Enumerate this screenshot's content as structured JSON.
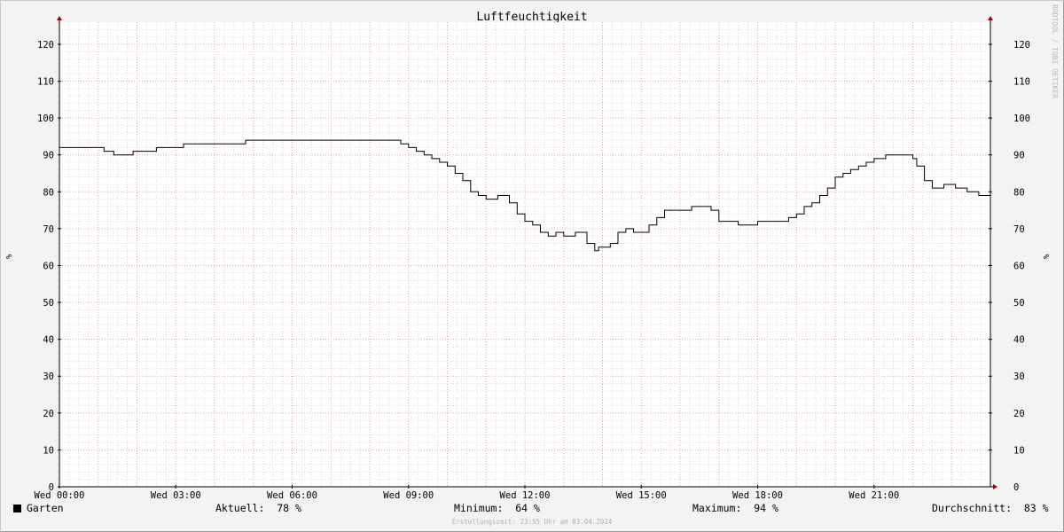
{
  "chart_data": {
    "type": "line",
    "title": "Luftfeuchtigkeit",
    "ylabel": "%",
    "ylabel_right": "%",
    "ylim": [
      0,
      126
    ],
    "yticks": [
      0,
      10,
      20,
      30,
      40,
      50,
      60,
      70,
      80,
      90,
      100,
      110,
      120
    ],
    "xlim": [
      0,
      24
    ],
    "xticks": [
      {
        "hour": 0,
        "label": "Wed 00:00"
      },
      {
        "hour": 3,
        "label": "Wed 03:00"
      },
      {
        "hour": 6,
        "label": "Wed 06:00"
      },
      {
        "hour": 9,
        "label": "Wed 09:00"
      },
      {
        "hour": 12,
        "label": "Wed 12:00"
      },
      {
        "hour": 15,
        "label": "Wed 15:00"
      },
      {
        "hour": 18,
        "label": "Wed 18:00"
      },
      {
        "hour": 21,
        "label": "Wed 21:00"
      }
    ],
    "grid": true,
    "series": [
      {
        "name": "Garten",
        "color": "#000000",
        "step": true,
        "x_hours": [
          0.0,
          1.15,
          1.4,
          1.4,
          1.9,
          2.5,
          3.2,
          4.8,
          6.4,
          8.65,
          8.8,
          9.0,
          9.2,
          9.4,
          9.6,
          9.8,
          10.0,
          10.2,
          10.4,
          10.6,
          10.8,
          11.0,
          11.3,
          11.6,
          11.8,
          12.0,
          12.2,
          12.4,
          12.6,
          12.8,
          13.0,
          13.3,
          13.6,
          13.8,
          13.9,
          14.0,
          14.2,
          14.4,
          14.6,
          14.8,
          15.0,
          15.2,
          15.4,
          15.6,
          15.8,
          16.0,
          16.3,
          16.5,
          16.8,
          17.0,
          17.2,
          17.5,
          18.0,
          18.4,
          18.8,
          19.0,
          19.2,
          19.4,
          19.6,
          19.8,
          20.0,
          20.2,
          20.4,
          20.6,
          20.8,
          21.0,
          21.3,
          21.6,
          21.9,
          22.0,
          22.1,
          22.3,
          22.5,
          22.8,
          23.1,
          23.4,
          23.7,
          24.0
        ],
        "values": [
          92,
          91,
          90,
          90,
          91,
          92,
          93,
          94,
          94,
          94,
          93,
          92,
          91,
          90,
          89,
          88,
          87,
          85,
          83,
          80,
          79,
          78,
          79,
          77,
          74,
          72,
          71,
          69,
          68,
          69,
          68,
          69,
          66,
          64,
          65,
          65,
          66,
          69,
          70,
          69,
          69,
          71,
          73,
          75,
          75,
          75,
          76,
          76,
          75,
          72,
          72,
          71,
          72,
          72,
          73,
          74,
          76,
          77,
          79,
          81,
          84,
          85,
          86,
          87,
          88,
          89,
          90,
          90,
          90,
          89,
          87,
          83,
          81,
          82,
          81,
          80,
          79,
          78
        ]
      }
    ],
    "legend": [
      {
        "key": "swatch",
        "label": "Garten"
      },
      {
        "key": "aktuell",
        "label": "Aktuell:  78 %"
      },
      {
        "key": "minimum",
        "label": "Minimum:  64 %"
      },
      {
        "key": "maximum",
        "label": "Maximum:  94 %"
      },
      {
        "key": "durchschnitt",
        "label": "Durchschnitt:  83 %"
      }
    ],
    "footer": "Erstellungszeit: 23:55 Uhr am 03.04.2024",
    "watermark": "RRDTOOL / TOBI OETIKER",
    "colors": {
      "background": "#f3f3f3",
      "plot_background": "#ffffff",
      "minor_grid": "#d9d9d9",
      "major_grid": "#f0a0a0",
      "axis_arrow": "#a00000",
      "line": "#000000"
    }
  }
}
